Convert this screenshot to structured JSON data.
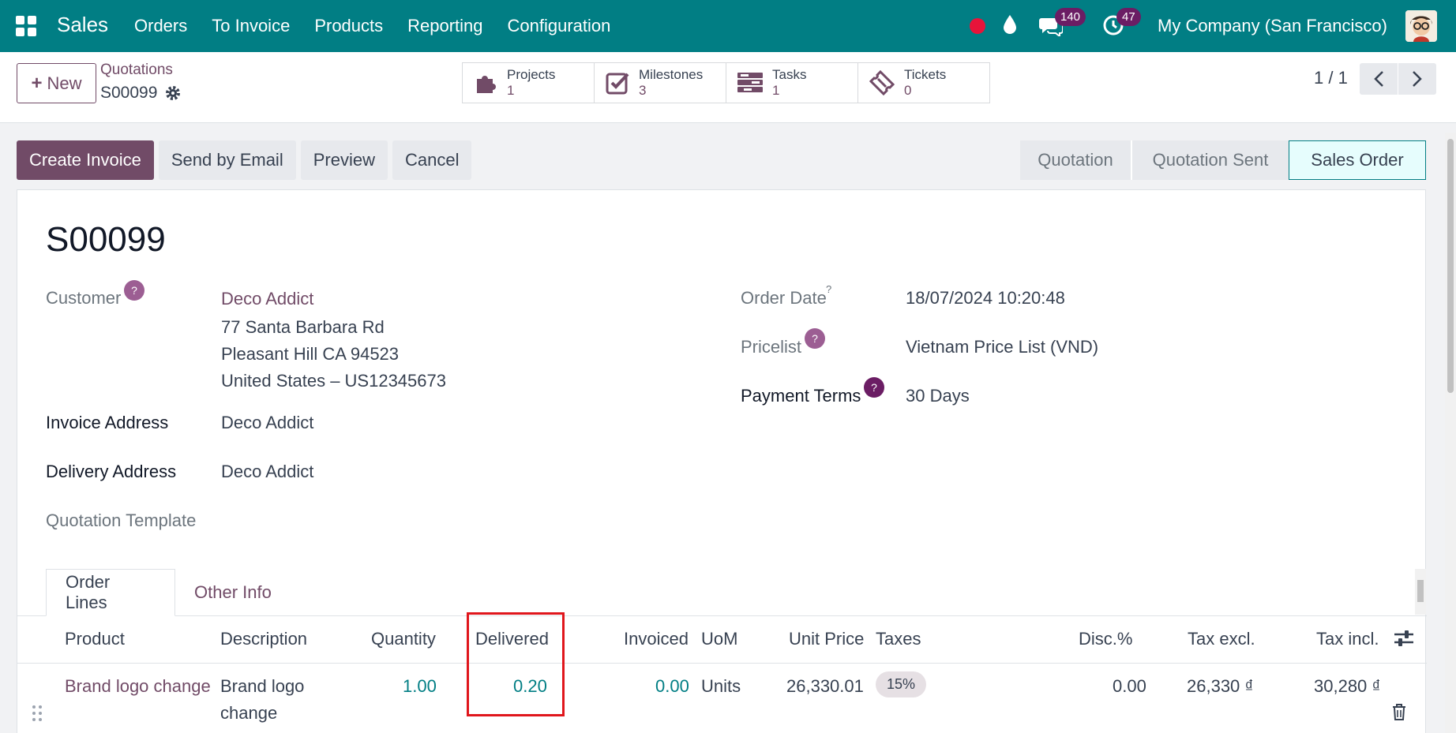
{
  "navbar": {
    "app_name": "Sales",
    "menu": [
      "Orders",
      "To Invoice",
      "Products",
      "Reporting",
      "Configuration"
    ],
    "messages_count": "140",
    "activities_count": "47",
    "company": "My Company (San Francisco)",
    "icons": [
      "apps-grid-icon",
      "record-dot-icon",
      "drop-icon",
      "chat-icon",
      "clock-icon",
      "avatar"
    ]
  },
  "control_panel": {
    "new_label": "New",
    "breadcrumb_parent": "Quotations",
    "breadcrumb_current": "S00099",
    "smart_buttons": [
      {
        "label": "Projects",
        "count": "1",
        "icon": "puzzle-icon"
      },
      {
        "label": "Milestones",
        "count": "3",
        "icon": "check-square-icon"
      },
      {
        "label": "Tasks",
        "count": "1",
        "icon": "tasks-icon"
      },
      {
        "label": "Tickets",
        "count": "0",
        "icon": "ticket-icon"
      }
    ],
    "pager": "1 / 1"
  },
  "statusbar": {
    "buttons": [
      "Create Invoice",
      "Send by Email",
      "Preview",
      "Cancel"
    ],
    "stages": [
      "Quotation",
      "Quotation Sent",
      "Sales Order"
    ],
    "active_stage": "Sales Order"
  },
  "form": {
    "title": "S00099",
    "customer_label": "Customer",
    "customer_name": "Deco Addict",
    "customer_address": [
      "77 Santa Barbara Rd",
      "Pleasant Hill CA 94523",
      "United States – US12345673"
    ],
    "invoice_address_label": "Invoice Address",
    "invoice_address": "Deco Addict",
    "delivery_address_label": "Delivery Address",
    "delivery_address": "Deco Addict",
    "quotation_template_label": "Quotation Template",
    "order_date_label": "Order Date",
    "order_date": "18/07/2024 10:20:48",
    "pricelist_label": "Pricelist",
    "pricelist": "Vietnam Price List (VND)",
    "payment_terms_label": "Payment Terms",
    "payment_terms": "30 Days",
    "help_mark": "?"
  },
  "tabs": [
    "Order Lines",
    "Other Info"
  ],
  "order_lines": {
    "columns": [
      "Product",
      "Description",
      "Quantity",
      "Delivered",
      "Invoiced",
      "UoM",
      "Unit Price",
      "Taxes",
      "Disc.%",
      "Tax excl.",
      "Tax incl."
    ],
    "rows": [
      {
        "product": "Brand logo change",
        "description_line1": "Brand logo",
        "description_line2": "change",
        "quantity": "1.00",
        "delivered": "0.20",
        "invoiced": "0.00",
        "uom": "Units",
        "unit_price": "26,330.01",
        "taxes": "15%",
        "discount": "0.00",
        "tax_excl": "26,330 ₫",
        "tax_incl": "30,280 ₫"
      }
    ]
  },
  "colors": {
    "navbar": "#017e84",
    "primary": "#714b67",
    "highlight": "#e0161c"
  }
}
